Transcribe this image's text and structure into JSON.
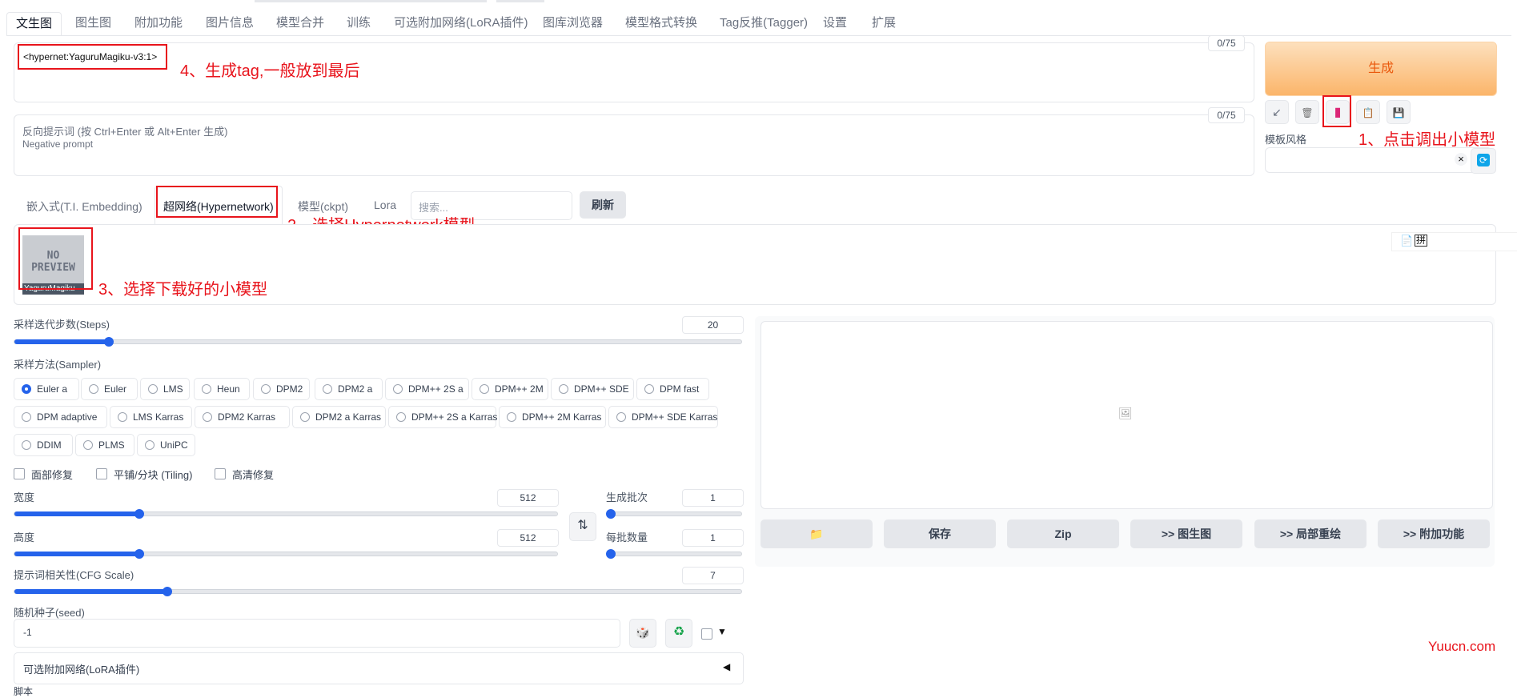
{
  "tabs": [
    "文生图",
    "图生图",
    "附加功能",
    "图片信息",
    "模型合并",
    "训练",
    "可选附加网络(LoRA插件)",
    "图库浏览器",
    "模型格式转换",
    "Tag反推(Tagger)",
    "设置",
    "扩展"
  ],
  "prompt": {
    "value": "<hypernet:YaguruMagiku-v3:1>",
    "counter": "0/75"
  },
  "negative": {
    "hint": "反向提示词 (按 Ctrl+Enter 或 Alt+Enter 生成)",
    "placeholder": "Negative prompt",
    "counter": "0/75"
  },
  "generate_label": "生成",
  "tools": {
    "arrow": "↙",
    "trash": "🗑",
    "book": "▮",
    "clip": "📋",
    "save": "💾"
  },
  "style": {
    "label": "模板风格",
    "clear": "×",
    "caret": "▾",
    "refresh": "⟳"
  },
  "network_tabs": [
    "嵌入式(T.I. Embedding)",
    "超网络(Hypernetwork)",
    "模型(ckpt)",
    "Lora"
  ],
  "search_placeholder": "搜索...",
  "refresh_label": "刷新",
  "card": {
    "preview_text": "NO\nPREVIEW",
    "name": "YaguruMagiku"
  },
  "side_icons": [
    "📄",
    "拼"
  ],
  "steps": {
    "label": "采样迭代步数(Steps)",
    "value": "20",
    "fraction": 0.13
  },
  "sampler": {
    "label": "采样方法(Sampler)",
    "options": [
      "Euler a",
      "Euler",
      "LMS",
      "Heun",
      "DPM2",
      "DPM2 a",
      "DPM++ 2S a",
      "DPM++ 2M",
      "DPM++ SDE",
      "DPM fast",
      "DPM adaptive",
      "LMS Karras",
      "DPM2 Karras",
      "DPM2 a Karras",
      "DPM++ 2S a Karras",
      "DPM++ 2M Karras",
      "DPM++ SDE Karras",
      "DDIM",
      "PLMS",
      "UniPC"
    ],
    "selected": "Euler a"
  },
  "checks": [
    "面部修复",
    "平铺/分块 (Tiling)",
    "高清修复"
  ],
  "width": {
    "label": "宽度",
    "value": "512",
    "fraction": 0.23
  },
  "height": {
    "label": "高度",
    "value": "512",
    "fraction": 0.23
  },
  "swap": "⇅",
  "batch_count": {
    "label": "生成批次",
    "value": "1",
    "fraction": 0.0
  },
  "batch_size": {
    "label": "每批数量",
    "value": "1",
    "fraction": 0.0
  },
  "cfg": {
    "label": "提示词相关性(CFG Scale)",
    "value": "7",
    "fraction": 0.21
  },
  "seed": {
    "label": "随机种子(seed)",
    "value": "-1",
    "dice": "🎲",
    "recycle": "♻",
    "caret": "▼"
  },
  "lora_section": {
    "label": "可选附加网络(LoRA插件)",
    "caret": "◀"
  },
  "script_label": "脚本",
  "output_buttons": [
    "📁",
    "保存",
    "Zip",
    ">> 图生图",
    ">> 局部重绘",
    ">> 附加功能"
  ],
  "image_icon": "🖼",
  "annotations": {
    "a1": "1、点击调出小模型",
    "a2": "2、选择Hypernetwork模型",
    "a3": "3、选择下载好的小模型",
    "a4": "4、生成tag,一般放到最后"
  },
  "watermark": "Yuucn.com"
}
